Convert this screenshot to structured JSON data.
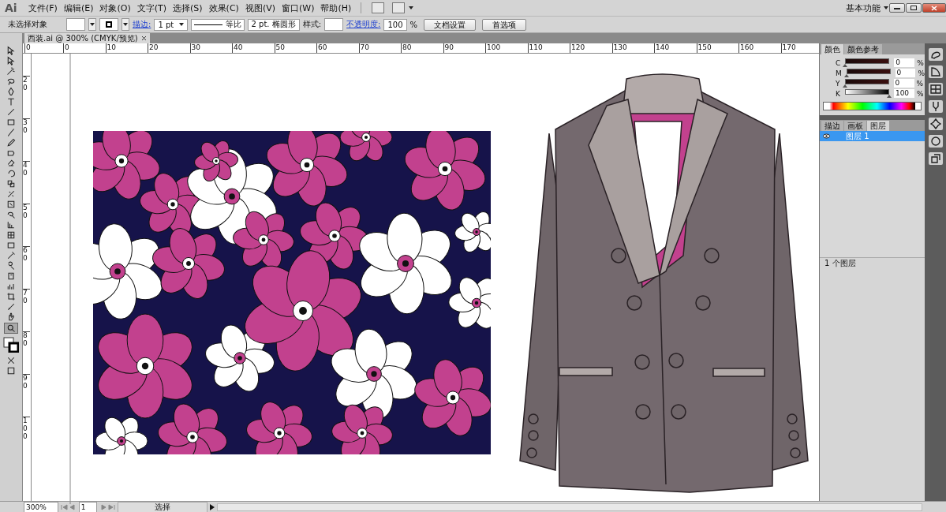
{
  "app_logo": "Ai",
  "menu": [
    "文件(F)",
    "编辑(E)",
    "对象(O)",
    "文字(T)",
    "选择(S)",
    "效果(C)",
    "视图(V)",
    "窗口(W)",
    "帮助(H)"
  ],
  "workspace": "基本功能",
  "control_bar": {
    "selection": "未选择对象",
    "stroke_label": "描边:",
    "stroke_weight": "1 pt",
    "stroke_profile": "等比",
    "brush": "2 pt. 椭圆形",
    "style_label": "样式:",
    "opacity_label": "不透明度:",
    "opacity": "100",
    "percent": "%",
    "buttons": [
      "文档设置",
      "首选项"
    ]
  },
  "document_tab": {
    "title": "西装.ai @ 300% (CMYK/预览)"
  },
  "ruler_h": [
    "0",
    "0",
    "10",
    "20",
    "30",
    "40",
    "50",
    "60",
    "70",
    "80",
    "90",
    "100",
    "110",
    "120",
    "130",
    "140",
    "150",
    "160",
    "170"
  ],
  "ruler_v": [
    "20",
    "30",
    "40",
    "50",
    "60",
    "70",
    "80",
    "90",
    "100"
  ],
  "color_panel": {
    "tabs": [
      {
        "label": "颜色",
        "selected": true
      },
      {
        "label": "颜色参考",
        "selected": false
      }
    ],
    "channels": [
      {
        "name": "C",
        "value": "0",
        "level": 0,
        "unit": "%"
      },
      {
        "name": "M",
        "value": "0",
        "level": 0,
        "unit": "%"
      },
      {
        "name": "Y",
        "value": "0",
        "level": 0,
        "unit": "%"
      },
      {
        "name": "K",
        "value": "100",
        "level": 1,
        "unit": "%"
      }
    ]
  },
  "layers_panel": {
    "tabs": [
      {
        "label": "描边",
        "selected": false
      },
      {
        "label": "画板",
        "selected": false
      },
      {
        "label": "图层",
        "selected": true
      }
    ],
    "layers": [
      {
        "name": "图层 1",
        "selected": true,
        "visible": true
      }
    ],
    "footer": "1 个图层"
  },
  "status_bar": {
    "zoom": "300%",
    "artboard": "1",
    "tool": "选择"
  }
}
